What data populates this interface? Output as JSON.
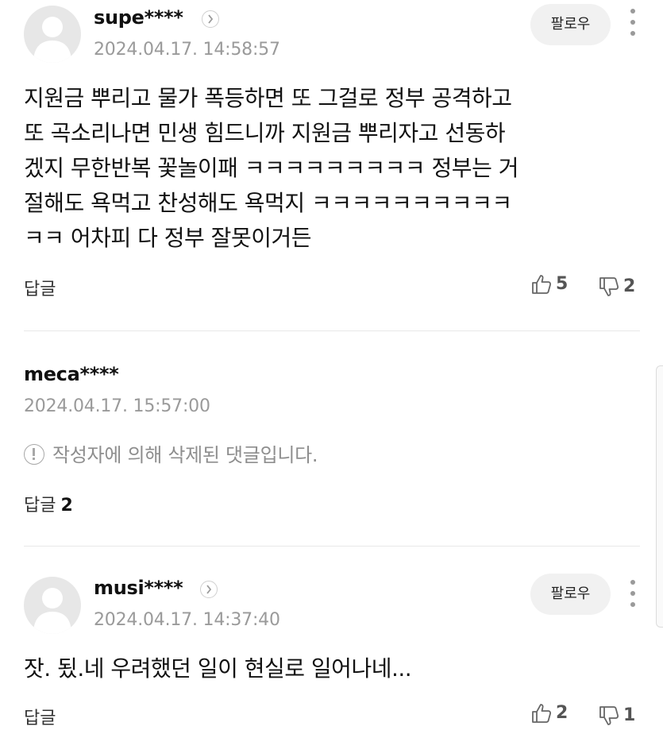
{
  "comments": [
    {
      "username": "supe****",
      "timestamp": "2024.04.17. 14:58:57",
      "follow_label": "팔로우",
      "body_lines": [
        "지원금 뿌리고 물가 폭등하면 또 그걸로 정부 공격하고",
        "또 곡소리나면 민생 힘드니까 지원금 뿌리자고 선동하",
        "겠지 무한반복 꽃놀이패 ㅋㅋㅋㅋㅋㅋㅋㅋㅋ 정부는 거",
        "절해도 욕먹고 찬성해도 욕먹지 ㅋㅋㅋㅋㅋㅋㅋㅋㅋㅋ",
        "ㅋㅋ 어차피 다 정부 잘못이거든"
      ],
      "reply_label": "답글",
      "likes": "5",
      "dislikes": "2"
    },
    {
      "username": "meca****",
      "timestamp": "2024.04.17. 15:57:00",
      "deleted_text": "작성자에 의해 삭제된 댓글입니다.",
      "reply_label": "답글",
      "reply_count": "2"
    },
    {
      "username": "musi****",
      "timestamp": "2024.04.17. 14:37:40",
      "follow_label": "팔로우",
      "body_lines": [
        "잣. 됬.네 우려했던 일이 현실로 일어나네..."
      ],
      "reply_label": "답글",
      "likes": "2",
      "dislikes": "1"
    }
  ],
  "icons": {
    "avatar": "default-avatar-icon",
    "profile_link": "chevron-right-icon",
    "more": "more-vertical-icon",
    "like": "thumbs-up-icon",
    "dislike": "thumbs-down-icon",
    "deleted_notice": "info-circle-icon"
  },
  "colors": {
    "timestamp": "#9a9a9a",
    "divider": "#e8e8e8",
    "follow_button_bg": "#f1f1f1",
    "deleted_text": "#8e8e8e"
  }
}
